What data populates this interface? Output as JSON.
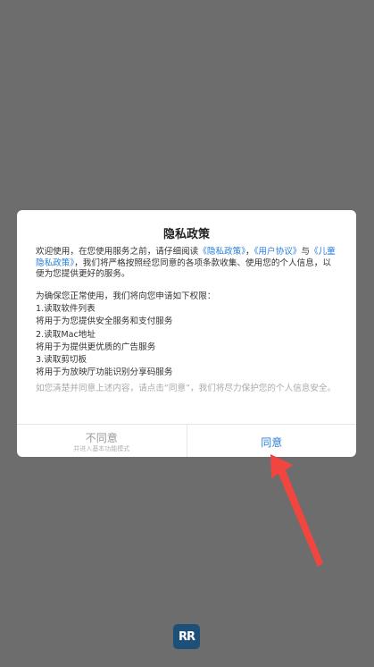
{
  "dialog": {
    "title": "隐私政策",
    "intro": {
      "p1": "欢迎使用，在您使用服务之前，请仔细阅读",
      "link_privacy": "《隐私政策》",
      "sep": "，",
      "link_user_agreement": "《用户协议》",
      "and": "与",
      "link_children_privacy": "《儿童隐私政策》",
      "p2": "，我们将严格按照经您同意的各项条款收集、使用您的个人信息，以便为您提供更好的服务。"
    },
    "permissions": {
      "heading": "为确保您正常使用，我们将向您申请如下权限：",
      "items": [
        "1.读取软件列表",
        "将用于为您提供安全服务和支付服务",
        "2.读取Mac地址",
        "将用于为提供更优质的广告服务",
        "3.读取剪切板",
        "将用于为放映厅功能识别分享码服务"
      ]
    },
    "notice": "如您清楚并同意上述内容，请点击“同意”，我们将尽力保护您的个人信息安全。",
    "disagree_label": "不同意",
    "disagree_sublabel": "并进入基本功能模式",
    "agree_label": "同意"
  },
  "logo": {
    "text": "RR"
  },
  "colors": {
    "overlay": "#6d6d6d",
    "accent": "#2b7fd9",
    "arrow": "#f0463f",
    "logo_bg": "#1e4f77"
  }
}
